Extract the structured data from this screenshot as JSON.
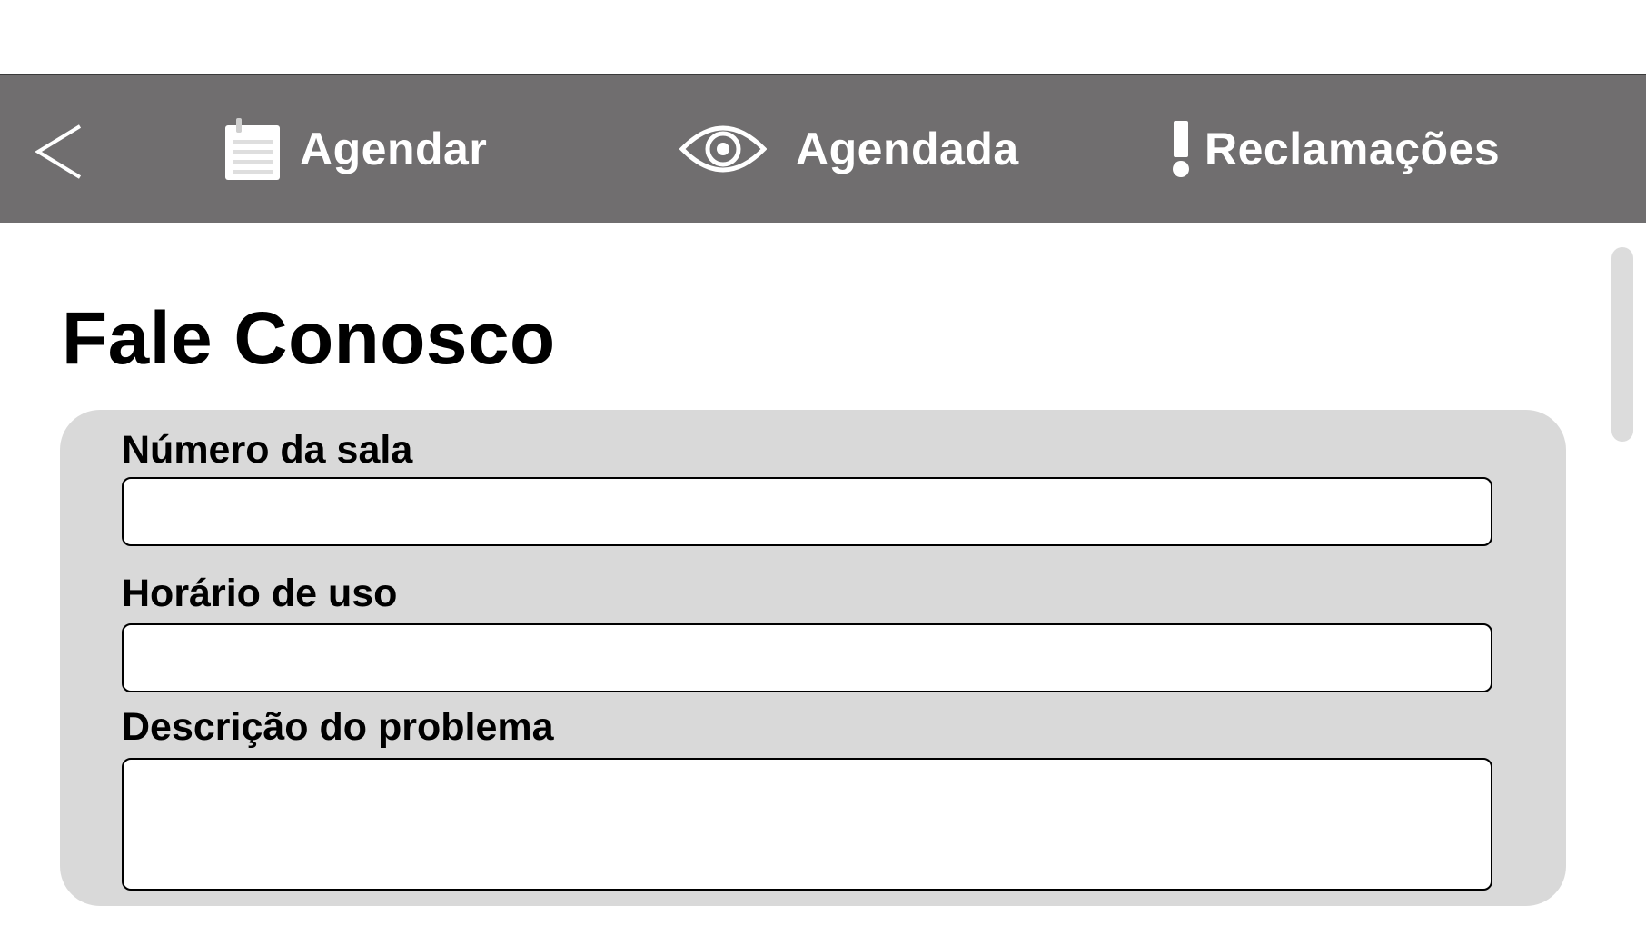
{
  "nav": {
    "back_icon": "chevron-left-icon",
    "items": [
      {
        "label": "Agendar",
        "icon": "notepad-icon"
      },
      {
        "label": "Agendada",
        "icon": "eye-icon"
      },
      {
        "label": "Reclamações",
        "icon": "exclamation-icon"
      }
    ]
  },
  "page": {
    "title": "Fale Conosco"
  },
  "form": {
    "fields": [
      {
        "label": "Número da sala",
        "value": ""
      },
      {
        "label": "Horário de uso",
        "value": ""
      },
      {
        "label": "Descrição do problema",
        "value": ""
      }
    ]
  },
  "colors": {
    "topbar": "#706e6f",
    "card": "#d9d9d9",
    "scrollbar": "#dcdcdc",
    "text": "#000000",
    "nav_text": "#ffffff"
  }
}
